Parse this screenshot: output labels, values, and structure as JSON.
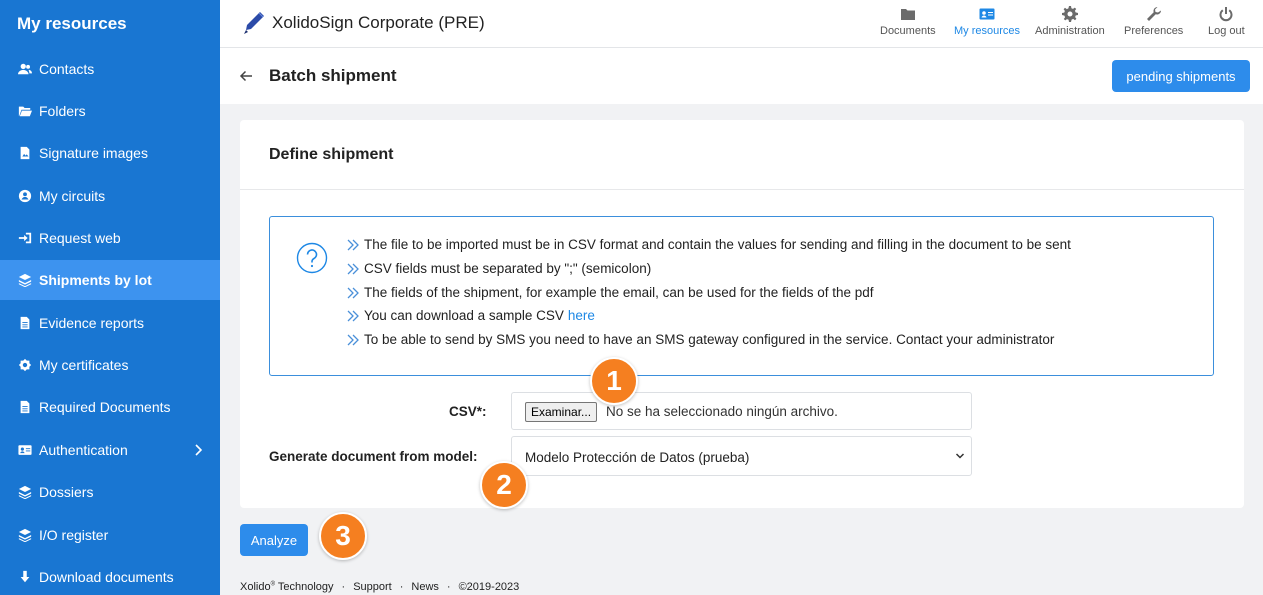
{
  "sidebar": {
    "title": "My resources",
    "items": [
      {
        "label": "Contacts",
        "icon": "users-icon"
      },
      {
        "label": "Folders",
        "icon": "folder-open-icon"
      },
      {
        "label": "Signature images",
        "icon": "image-file-icon"
      },
      {
        "label": "My circuits",
        "icon": "circuit-icon"
      },
      {
        "label": "Request web",
        "icon": "sign-in-icon"
      },
      {
        "label": "Shipments by lot",
        "icon": "layers-icon",
        "active": true
      },
      {
        "label": "Evidence reports",
        "icon": "document-icon"
      },
      {
        "label": "My certificates",
        "icon": "certificate-icon"
      },
      {
        "label": "Required Documents",
        "icon": "documents-icon"
      },
      {
        "label": "Authentication",
        "icon": "id-card-icon"
      },
      {
        "label": "Dossiers",
        "icon": "layers-icon"
      },
      {
        "label": "I/O register",
        "icon": "layers-icon"
      },
      {
        "label": "Download documents",
        "icon": "download-icon"
      }
    ]
  },
  "header": {
    "brand": "XolidoSign Corporate (PRE)",
    "nav": [
      {
        "label": "Documents",
        "icon": "folder-icon"
      },
      {
        "label": "My resources",
        "icon": "id-card-icon",
        "active": true
      },
      {
        "label": "Administration",
        "icon": "gear-icon"
      },
      {
        "label": "Preferences",
        "icon": "wrench-icon"
      },
      {
        "label": "Log out",
        "icon": "power-icon"
      }
    ]
  },
  "page": {
    "title": "Batch shipment",
    "pending_label": "pending shipments"
  },
  "card": {
    "title": "Define shipment",
    "info": [
      "The file to be imported must be in CSV format and contain the values for sending and filling in the document to be sent",
      "CSV fields must be separated by \";\" (semicolon)",
      "The fields of the shipment, for example the email, can be used for the fields of the pdf",
      "You can download a sample CSV",
      "To be able to send by SMS you need to have an SMS gateway configured in the service. Contact your administrator"
    ],
    "info_link": "here",
    "csv_label": "CSV*:",
    "file_button": "Examinar...",
    "file_status": "No se ha seleccionado ningún archivo.",
    "model_label": "Generate document from model:",
    "model_selected": "Modelo Protección de Datos (prueba)"
  },
  "analyze_label": "Analyze",
  "badges": [
    "1",
    "2",
    "3"
  ],
  "footer": {
    "company": "Xolido",
    "reg": "®",
    "company_rest": " Technology",
    "support": "Support",
    "news": "News",
    "copyright": "©2019-2023",
    "sep": "·"
  },
  "colors": {
    "sidebar": "#1976d2",
    "active_item": "#3d93ef",
    "accent": "#2d8ceb",
    "badge": "#f57f20"
  }
}
